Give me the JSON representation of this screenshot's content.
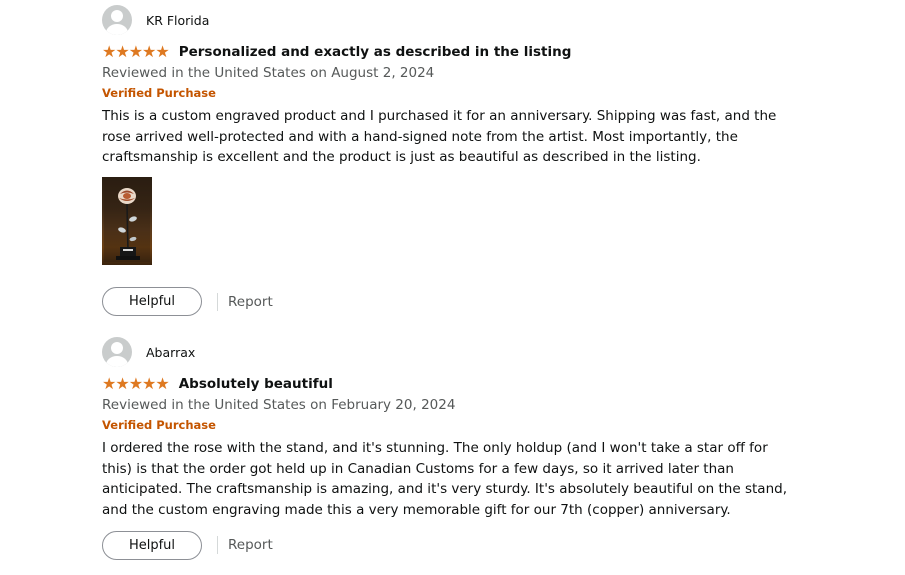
{
  "reviews": [
    {
      "reviewer": "KR Florida",
      "rating": 5,
      "stars": "★★★★★",
      "title": "Personalized and exactly as described in the listing",
      "reviewed_line": "Reviewed in the United States on August 2, 2024",
      "badge": "Verified Purchase",
      "body": "This is a custom engraved product and I purchased it for an anniversary. Shipping was fast, and the rose arrived well-protected and with a hand-signed note from the artist. Most importantly, the craftsmanship is excellent and the product is just as beautiful as described in the listing.",
      "helpful_label": "Helpful",
      "report_label": "Report"
    },
    {
      "reviewer": "Abarrax",
      "rating": 5,
      "stars": "★★★★★",
      "title": "Absolutely beautiful",
      "reviewed_line": "Reviewed in the United States on February 20, 2024",
      "badge": "Verified Purchase",
      "body": "I ordered the rose with the stand, and it's stunning. The only holdup (and I won't take a star off for this) is that the order got held up in Canadian Customs for a few days, so it arrived later than anticipated. The craftsmanship is amazing, and it's very sturdy. It's absolutely beautiful on the stand, and the custom engraving made this a very memorable gift for our 7th (copper) anniversary.",
      "helpful_label": "Helpful",
      "report_label": "Report"
    }
  ],
  "colors": {
    "star": "#de7921",
    "verified": "#c45500",
    "secondary_text": "#565959"
  },
  "icons": [
    "default-avatar-icon",
    "star-icon",
    "review-photo-thumbnail"
  ]
}
